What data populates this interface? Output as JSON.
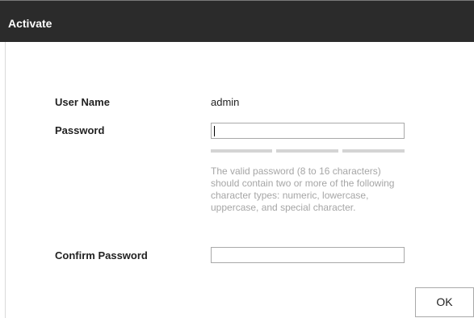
{
  "dialog": {
    "title": "Activate"
  },
  "form": {
    "username_label": "User Name",
    "username_value": "admin",
    "password_label": "Password",
    "password_value": "",
    "password_strength_level": 0,
    "password_hint": "The valid password (8 to 16 characters) should contain two or more of the following character types: numeric, lowercase, uppercase, and special character.",
    "confirm_label": "Confirm Password",
    "confirm_value": ""
  },
  "buttons": {
    "ok_label": "OK"
  },
  "colors": {
    "titlebar_bg": "#2b2b2b",
    "hint_text": "#a6a6a6",
    "strength_empty": "#d4d4d4"
  }
}
